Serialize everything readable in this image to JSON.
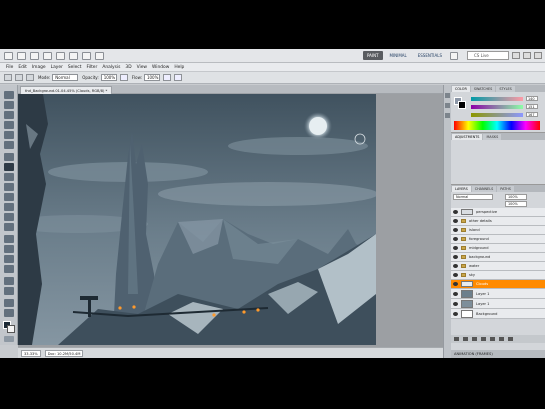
{
  "app": {
    "workspaces": [
      "PAINT",
      "MINIMAL",
      "ESSENTIALS"
    ],
    "active_workspace": "PAINT",
    "cs_live": "CS Live"
  },
  "menu": [
    "File",
    "Edit",
    "Image",
    "Layer",
    "Select",
    "Filter",
    "Analysis",
    "3D",
    "View",
    "Window",
    "Help"
  ],
  "options": {
    "mode_label": "Mode:",
    "mode_value": "Normal",
    "opacity_label": "Opacity:",
    "opacity_value": "100%",
    "flow_label": "Flow:",
    "flow_value": "100%"
  },
  "document": {
    "tab_title": "thd_Background.01.04.45% (Clouds, RGB/8) *"
  },
  "status": {
    "zoom": "33.33%",
    "doc_size": "Doc: 10.2M/50.4M"
  },
  "color_panel": {
    "tabs": [
      "COLOR",
      "SWATCHES",
      "STYLES"
    ],
    "values": [
      "140",
      "151",
      "167"
    ]
  },
  "adjust_panel": {
    "tabs": [
      "ADJUSTMENTS",
      "MASKS"
    ]
  },
  "layers_panel": {
    "tabs": [
      "LAYERS",
      "CHANNELS",
      "PATHS"
    ],
    "blend_mode": "Normal",
    "opacity": "100%",
    "fill": "100%",
    "layers": [
      {
        "name": "perspective",
        "type": "layer"
      },
      {
        "name": "other details",
        "type": "folder"
      },
      {
        "name": "island",
        "type": "folder"
      },
      {
        "name": "foreground",
        "type": "folder"
      },
      {
        "name": "midground",
        "type": "folder"
      },
      {
        "name": "background",
        "type": "folder"
      },
      {
        "name": "water",
        "type": "folder"
      },
      {
        "name": "sky",
        "type": "folder"
      },
      {
        "name": "Clouds",
        "type": "layer",
        "selected": true
      },
      {
        "name": "Layer 1",
        "type": "layer"
      },
      {
        "name": "Layer 1",
        "type": "layer"
      },
      {
        "name": "Background",
        "type": "layer"
      }
    ]
  },
  "history_panel": {
    "label": "ANIMATION (FRAMES)"
  },
  "colors": {
    "accent_selected": "#ff8a00",
    "active_workspace": "#595c60",
    "sky": "#5f7281"
  }
}
